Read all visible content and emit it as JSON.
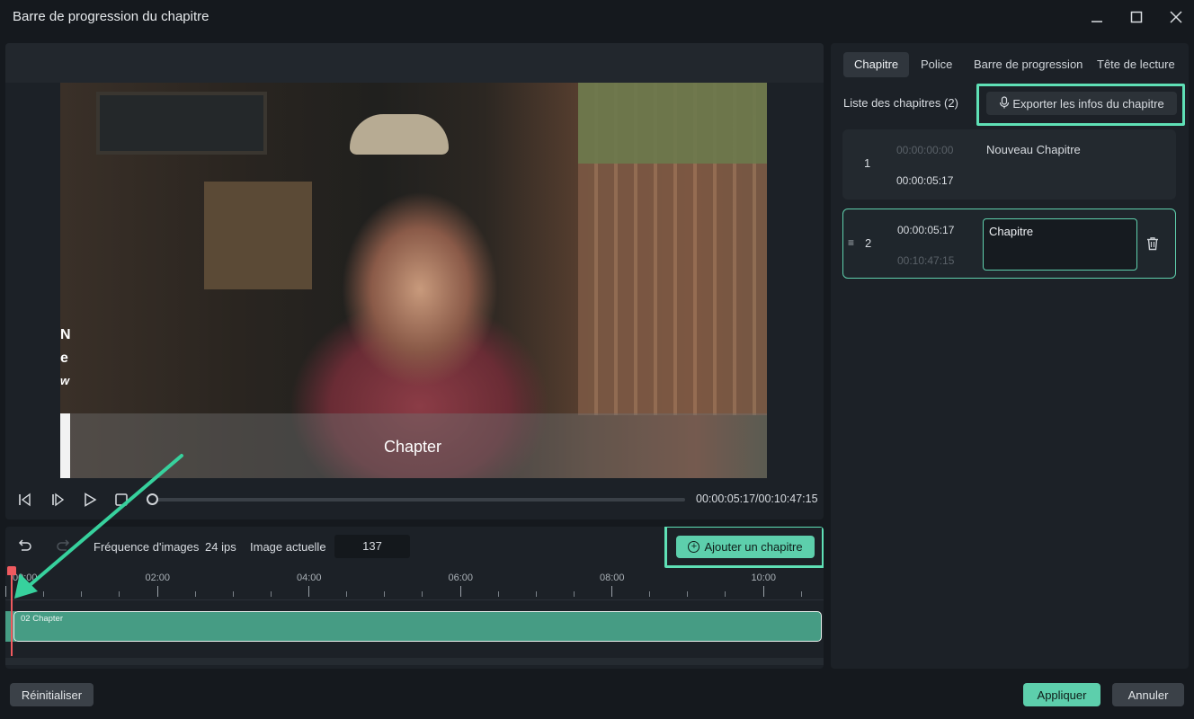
{
  "window": {
    "title": "Barre de progression du chapitre",
    "minimize_icon": "minimize-icon",
    "maximize_icon": "maximize-icon",
    "close_icon": "close-icon"
  },
  "preview": {
    "video_caption": "Chapter",
    "video_edge_text": [
      "N",
      "e",
      "w"
    ],
    "timecode": "00:00:05:17/00:10:47:15",
    "controls": [
      "prev-frame-icon",
      "next-frame-icon",
      "play-icon",
      "stop-icon"
    ],
    "progress": 0.01
  },
  "timeline": {
    "fps_label": "Fréquence d'images",
    "fps_value": "24 ips",
    "frame_label": "Image actuelle",
    "frame_value": "137",
    "add_chapter_label": "Ajouter un chapitre",
    "ruler_labels": [
      "00:00",
      "02:00",
      "04:00",
      "06:00",
      "08:00",
      "10:00"
    ],
    "track_label": "02 Chapter"
  },
  "right_panel": {
    "tabs": [
      "Chapitre",
      "Police",
      "Barre de progression",
      "Tête de lecture"
    ],
    "active_tab": "Chapitre",
    "list_title": "Liste des chapitres (2)",
    "export_label": "Exporter les infos du chapitre",
    "chapters": [
      {
        "index": "1",
        "start": "00:00:00:00",
        "end": "00:00:05:17",
        "name": "Nouveau Chapitre"
      },
      {
        "index": "2",
        "start": "00:00:05:17",
        "end": "00:10:47:15",
        "name": "Chapitre"
      }
    ]
  },
  "footer": {
    "reset_label": "Réinitialiser",
    "apply_label": "Appliquer",
    "cancel_label": "Annuler"
  },
  "colors": {
    "accent": "#5dcfac",
    "highlight": "#5fe0b6",
    "playhead": "#ef5a5f",
    "background": "#15191e"
  }
}
